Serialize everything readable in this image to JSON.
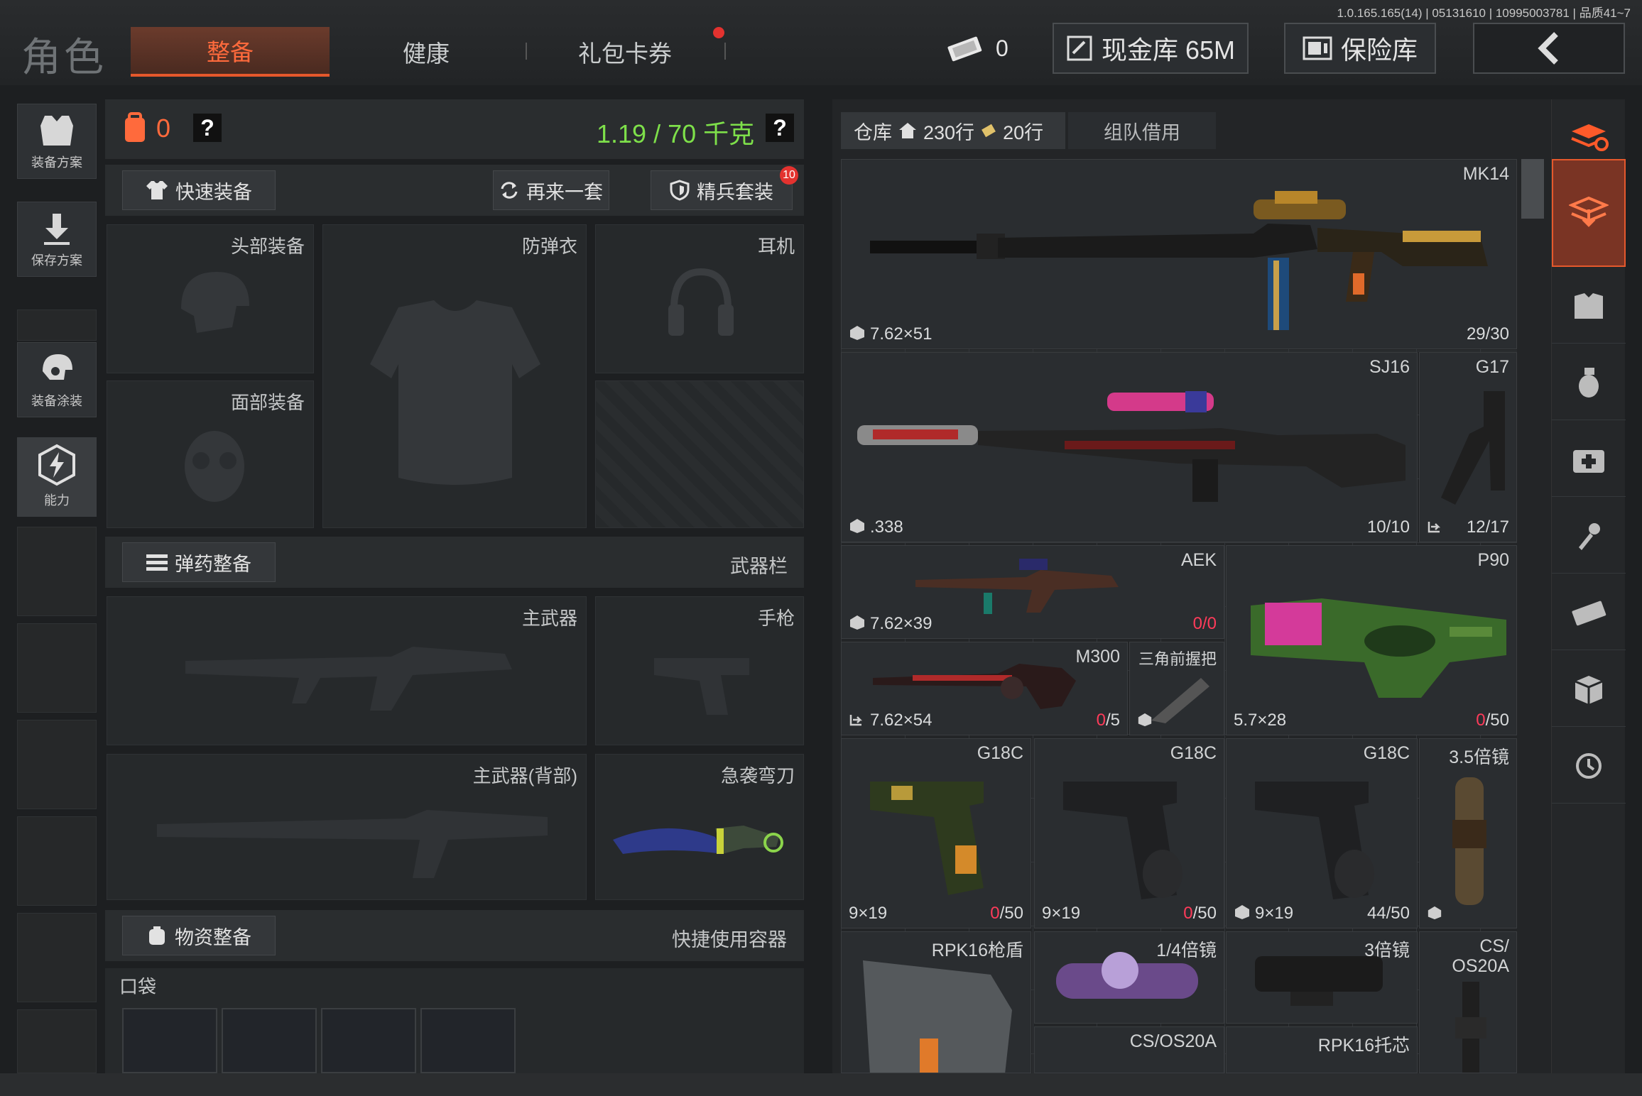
{
  "version": "1.0.165.165(14) | 05131610 | 10995003781 | 品质41~7",
  "title": "角色",
  "tabs": {
    "equip": "整备",
    "health": "健康",
    "gift": "礼包卡券"
  },
  "currency": {
    "tickets": "0",
    "cash_label": "现金库 65M",
    "safe_label": "保险库"
  },
  "sidebar": {
    "plan": "装备方案",
    "save": "保存方案",
    "skin": "装备涂装",
    "ability": "能力"
  },
  "equip": {
    "backpack_count": "0",
    "help": "?",
    "weight": "1.19 / 70 千克",
    "quick_equip": "快速装备",
    "again": "再来一套",
    "elite": "精兵套装",
    "elite_badge": "10",
    "head": "头部装备",
    "armor": "防弹衣",
    "headset": "耳机",
    "face": "面部装备",
    "ammo": "弹药整备",
    "weapon_bar": "武器栏",
    "primary": "主武器",
    "pistol": "手枪",
    "primary_back": "主武器(背部)",
    "melee": "急袭弯刀",
    "supplies": "物资整备",
    "quick_container": "快捷使用容器",
    "pocket": "口袋"
  },
  "inventory": {
    "warehouse": "仓库",
    "rows": "230行",
    "rows2": "20行",
    "team_borrow": "组队借用",
    "items": [
      {
        "name": "MK14",
        "caliber": "7.62×51",
        "ammo": "29/30"
      },
      {
        "name": "SJ16",
        "caliber": ".338",
        "ammo": "10/10"
      },
      {
        "name": "G17",
        "caliber": "",
        "ammo": "12/17"
      },
      {
        "name": "AEK",
        "caliber": "7.62×39",
        "ammo_a": "0",
        "ammo_b": "/0"
      },
      {
        "name": "P90",
        "caliber": "5.7×28",
        "ammo_a": "0",
        "ammo_b": "/50"
      },
      {
        "name": "M300",
        "caliber": "7.62×54",
        "ammo_a": "0",
        "ammo_b": "/5"
      },
      {
        "name": "三角前握把"
      },
      {
        "name": "G18C",
        "caliber": "9×19",
        "ammo_a": "0",
        "ammo_b": "/50"
      },
      {
        "name": "G18C",
        "caliber": "9×19",
        "ammo_a": "0",
        "ammo_b": "/50"
      },
      {
        "name": "G18C",
        "caliber": "9×19",
        "ammo": "44/50"
      },
      {
        "name": "3.5倍镜"
      },
      {
        "name": "RPK16枪盾"
      },
      {
        "name": "1/4倍镜"
      },
      {
        "name": "3倍镜"
      },
      {
        "name": "CS/\nOS20A"
      },
      {
        "name": "CS/OS20A"
      },
      {
        "name": "RPK16托芯"
      }
    ]
  },
  "colors": {
    "accent": "#ff6a3c",
    "weight": "#7ee04a",
    "alert": "#ff3b5a"
  }
}
